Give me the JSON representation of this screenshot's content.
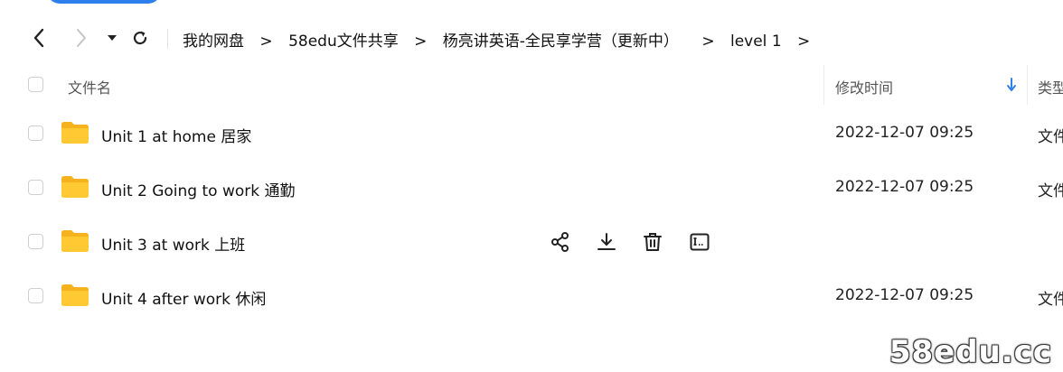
{
  "breadcrumb": {
    "items": [
      "我的网盘",
      "58edu文件共享",
      "杨亮讲英语-全民享学营（更新中）",
      "level 1"
    ],
    "separator": ">"
  },
  "table": {
    "columns": {
      "name": "文件名",
      "modified": "修改时间",
      "type": "类型"
    },
    "rows": [
      {
        "name": "Unit 1 at home 居家",
        "modified": "2022-12-07 09:25",
        "type": "文件夹"
      },
      {
        "name": "Unit 2 Going to work 通勤",
        "modified": "2022-12-07 09:25",
        "type": "文件夹"
      },
      {
        "name": "Unit 3 at work 上班",
        "modified": "",
        "type": ""
      },
      {
        "name": "Unit 4 after work 休闲",
        "modified": "2022-12-07 09:25",
        "type": "文件夹"
      }
    ]
  },
  "hover_actions": [
    "share-icon",
    "download-icon",
    "delete-icon",
    "rename-icon"
  ],
  "watermark": "58edu.cc",
  "colors": {
    "accent": "#2f80ed",
    "folder": "#ffc933",
    "folder_tab": "#f5b21c"
  }
}
